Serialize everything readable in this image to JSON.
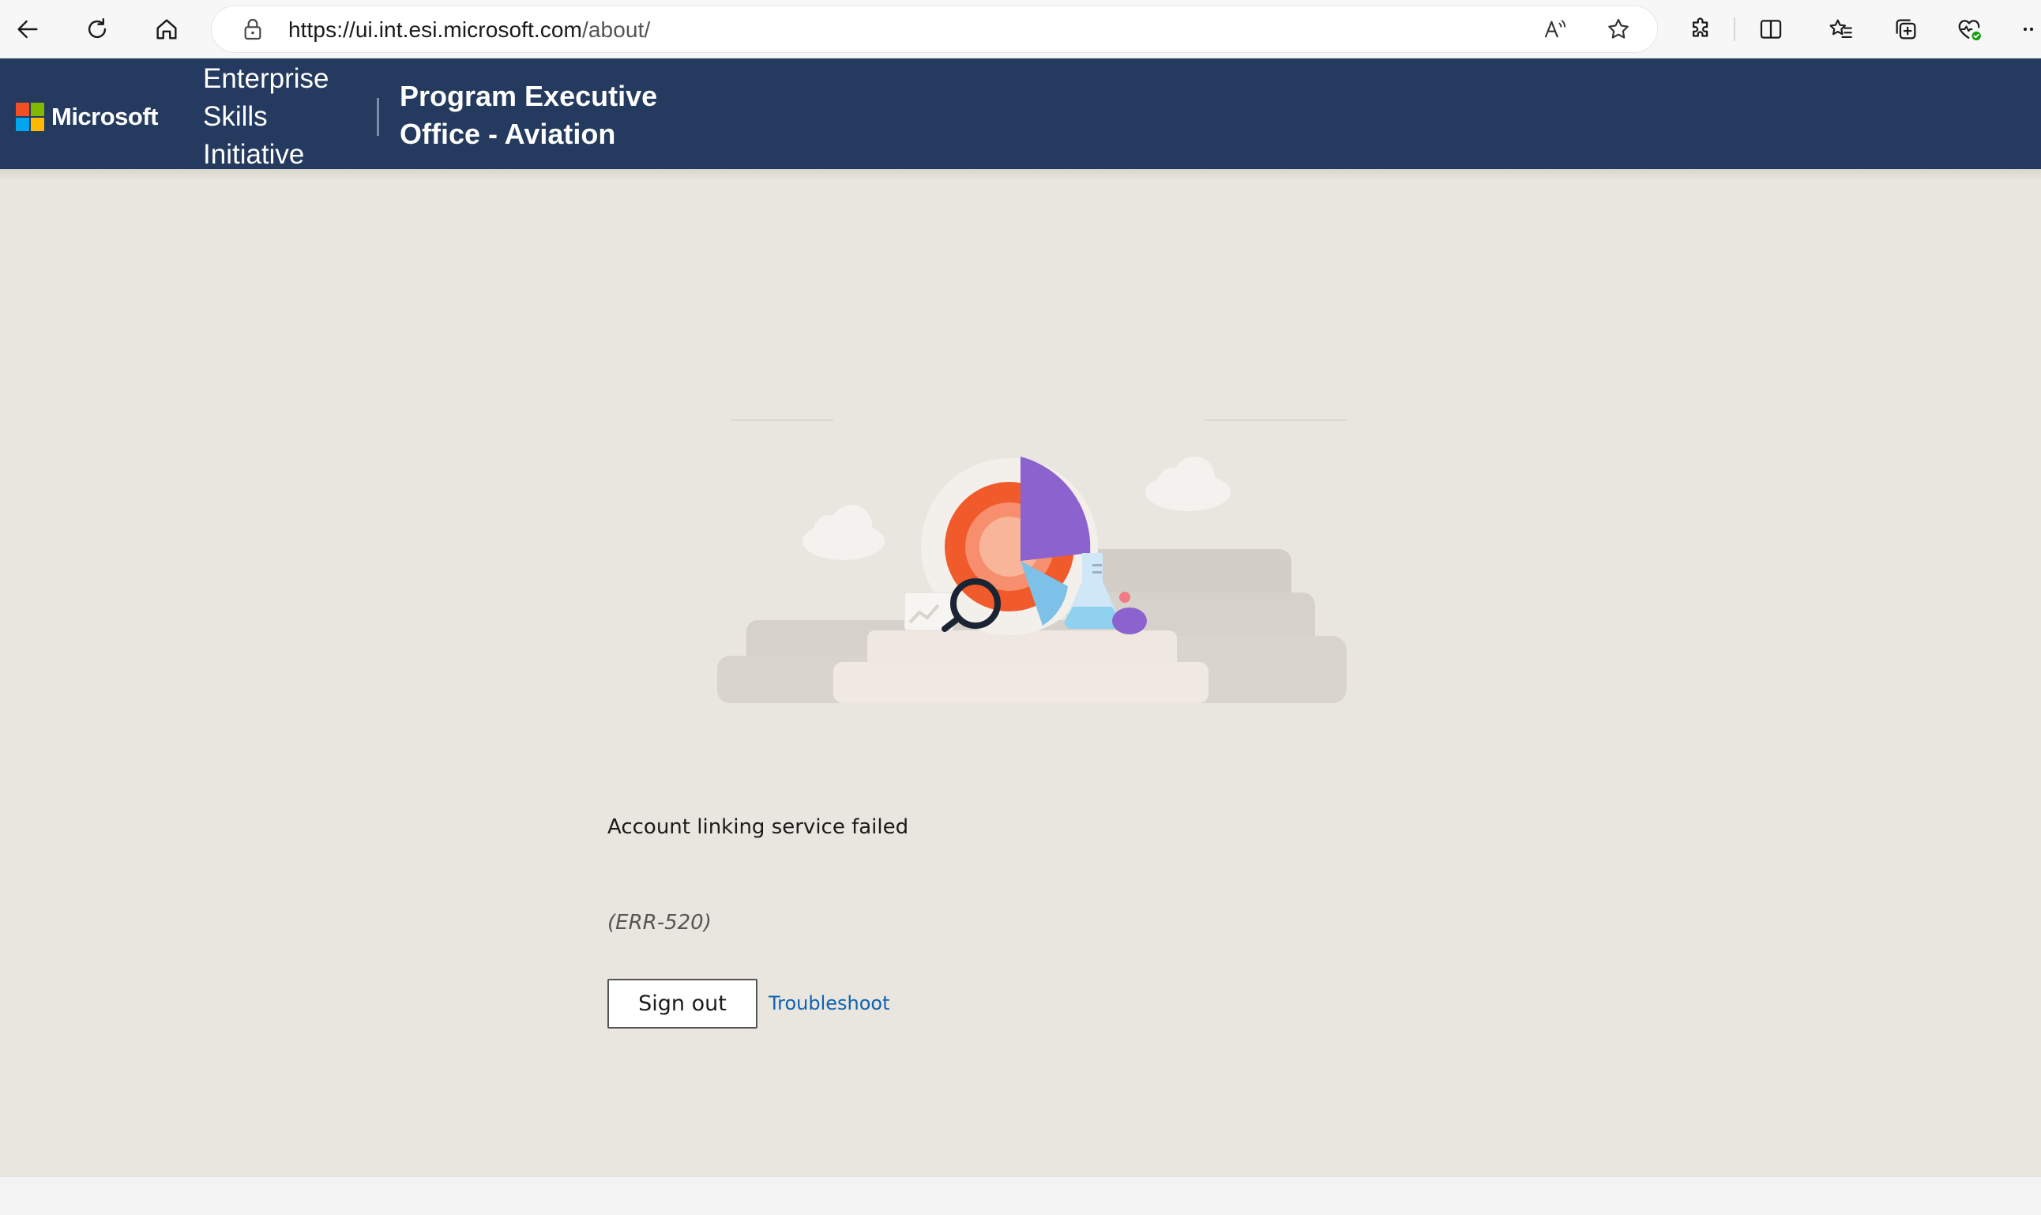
{
  "browser": {
    "url_host": "https://ui.int.esi.microsoft.com",
    "url_path": "/about/",
    "icons": {
      "back": "arrow-left-icon",
      "refresh": "refresh-icon",
      "home": "home-icon",
      "lock": "lock-icon",
      "read_aloud": "read-aloud-icon",
      "favorite": "star-icon",
      "extensions": "puzzle-icon",
      "split_screen": "split-screen-icon",
      "favorites": "favorites-icon",
      "collections": "collections-icon",
      "browser_essentials": "heart-pulse-icon",
      "more": "more-icon"
    }
  },
  "header": {
    "brand": "Microsoft",
    "site_title": "Enterprise Skills Initiative",
    "program_title": "Program Executive Office - Aviation",
    "background_color": "#243a5e"
  },
  "error": {
    "message": "Account linking service failed",
    "code": "(ERR-520)",
    "sign_out_label": "Sign out",
    "troubleshoot_label": "Troubleshoot",
    "link_color": "#0f62b0"
  }
}
